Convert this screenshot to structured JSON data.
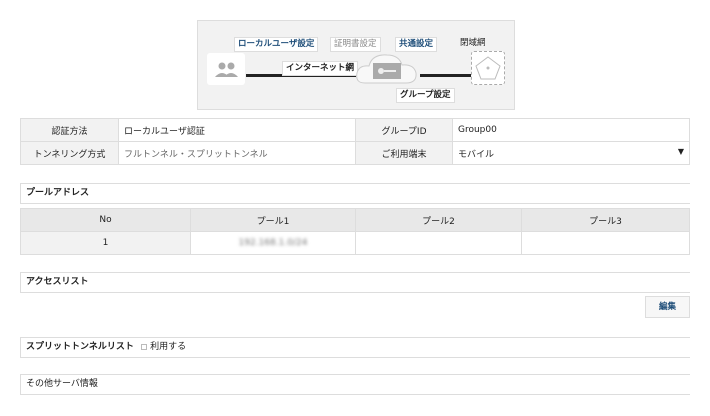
{
  "diagram": {
    "local_user_setting": "ローカルユーザ設定",
    "cert_setting": "証明書設定",
    "common_setting": "共通設定",
    "closed_network": "閉域網",
    "internet": "インターネット網",
    "group_setting": "グループ設定"
  },
  "info": {
    "auth_label": "認証方法",
    "auth_value": "ローカルユーザ認証",
    "group_id_label": "グループID",
    "group_id_value": "Group00",
    "tunnel_label": "トンネリング方式",
    "tunnel_value": "フルトンネル・スプリットトンネル",
    "device_label": "ご利用端末",
    "device_value": "モバイル"
  },
  "pool": {
    "title": "プールアドレス",
    "headers": [
      "No",
      "プール1",
      "プール2",
      "プール3"
    ],
    "rows": [
      [
        "1",
        "192.168.1.0/24",
        "",
        ""
      ]
    ]
  },
  "access_list": {
    "title": "アクセスリスト",
    "edit_label": "編集"
  },
  "split_tunnel": {
    "title": "スプリットトンネルリスト",
    "use_label": "利用する"
  },
  "other": {
    "title": "その他サーバ情報"
  }
}
